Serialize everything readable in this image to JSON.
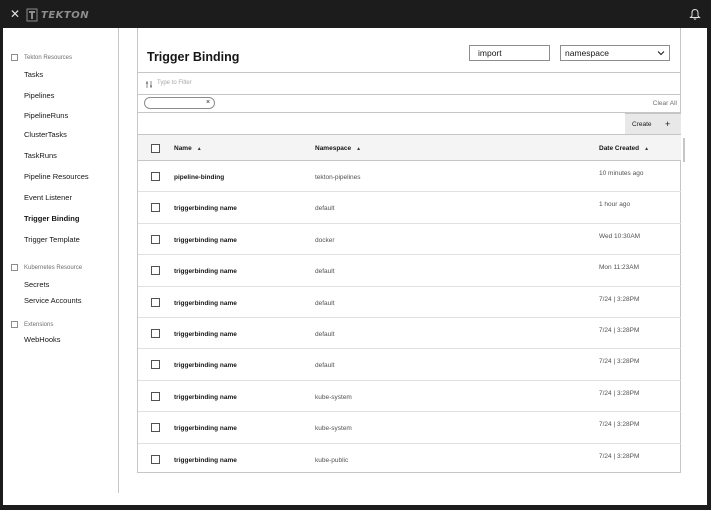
{
  "window": {
    "brand": "TEKTON",
    "icons": {
      "close": "close-icon",
      "logo": "tekton-logo-icon",
      "notifications": "bell-icon"
    }
  },
  "sidebar": {
    "groups": [
      {
        "label": "Tekton Resources",
        "items": [
          "Tasks",
          "Pipelines",
          "PipelineRuns",
          "ClusterTasks",
          "TaskRuns",
          "Pipeline Resources",
          "Event Listener",
          "Trigger Binding",
          "Trigger Template"
        ]
      },
      {
        "label": "Kubernetes Resource",
        "items": [
          "Secrets",
          "Service Accounts"
        ]
      },
      {
        "label": "Extensions",
        "items": [
          "WebHooks"
        ]
      }
    ],
    "active_item": "Trigger Binding"
  },
  "main": {
    "title": "Trigger Binding",
    "import_input": {
      "value": "import"
    },
    "namespace_select": {
      "value": "namespace",
      "icon": "chevron-down-icon"
    },
    "filter": {
      "placeholder": "Type to Filter",
      "icon": "filter-icon"
    },
    "filter_tag": {
      "close": "×"
    },
    "clear_all": "Clear All",
    "create_button": {
      "label": "Create",
      "icon": "+"
    },
    "table": {
      "headers": {
        "name": "Name",
        "namespace": "Namespace",
        "date": "Date Created"
      },
      "sort_icon": "▲",
      "rows": [
        {
          "name": "pipeline-binding",
          "namespace": "tekton-pipelines",
          "date": "10 minutes ago"
        },
        {
          "name": "triggerbinding name",
          "namespace": "default",
          "date": "1 hour ago"
        },
        {
          "name": "triggerbinding name",
          "namespace": "docker",
          "date": "Wed 10:30AM"
        },
        {
          "name": "triggerbinding name",
          "namespace": "default",
          "date": "Mon 11:23AM"
        },
        {
          "name": "triggerbinding name",
          "namespace": "default",
          "date": "7/24 | 3:28PM"
        },
        {
          "name": "triggerbinding name",
          "namespace": "default",
          "date": "7/24 | 3:28PM"
        },
        {
          "name": "triggerbinding name",
          "namespace": "default",
          "date": "7/24 | 3:28PM"
        },
        {
          "name": "triggerbinding name",
          "namespace": "kube-system",
          "date": "7/24 | 3:28PM"
        },
        {
          "name": "triggerbinding name",
          "namespace": "kube-system",
          "date": "7/24 | 3:28PM"
        },
        {
          "name": "triggerbinding name",
          "namespace": "kube-public",
          "date": "7/24 | 3:28PM"
        }
      ]
    }
  },
  "colors": {
    "chrome": "#1c1c1c",
    "text": "#161616",
    "muted": "#6f6f6f",
    "border": "#c6c6c6",
    "header_bg": "#f4f4f4",
    "button_bg": "#e8e8e8"
  }
}
